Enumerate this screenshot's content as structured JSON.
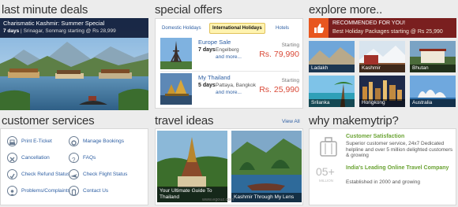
{
  "sections": {
    "deals": "last minute deals",
    "offers": "special offers",
    "explore": "explore more..",
    "services": "customer services",
    "travel": "travel ideas",
    "why": "why makemytrip?"
  },
  "deal": {
    "title": "Charismatic Kashmir: Summer Special",
    "days": "7 days",
    "detail": "Srinagar, Sonmarg starting @ Rs 28,999"
  },
  "offers": {
    "tabs": [
      "Domestic Holidays",
      "International Holidays",
      "Hotels"
    ],
    "active_tab": "International Holidays",
    "items": [
      {
        "name": "Europe Sale",
        "days": "7 days",
        "place": "Engelberg",
        "more": "and more...",
        "starting": "Starting",
        "price": "Rs. 79,990"
      },
      {
        "name": "My Thailand",
        "days": "5 days",
        "place": "Pattaya, Bangkok",
        "more": "and more...",
        "starting": "Starting",
        "price": "Rs. 25,990"
      }
    ]
  },
  "explore": {
    "recommended": "RECOMMENDED FOR YOU!",
    "recommended_detail": "Best Holiday Packages starting @ Rs 25,990",
    "destinations": [
      "Ladakh",
      "Kashmir",
      "Bhutan",
      "Srilanka",
      "Hongkong",
      "Australia"
    ]
  },
  "services": {
    "items": [
      {
        "label": "Print E-Ticket",
        "icon": "printer-icon"
      },
      {
        "label": "Manage Bookings",
        "icon": "gear-icon"
      },
      {
        "label": "Cancellation",
        "icon": "cancel-icon"
      },
      {
        "label": "FAQs",
        "icon": "question-icon"
      },
      {
        "label": "Check Refund Status",
        "icon": "refund-icon"
      },
      {
        "label": "Check Flight Status",
        "icon": "plane-icon"
      },
      {
        "label": "Problems/Complaints",
        "icon": "person-icon"
      },
      {
        "label": "Contact Us",
        "icon": "phone-icon"
      }
    ]
  },
  "travel": {
    "view_all": "View All",
    "ideas": [
      {
        "caption": "Your Ultimate Guide To Thailand"
      },
      {
        "caption": "Kashmir Through My Lens"
      }
    ]
  },
  "why": {
    "items": [
      {
        "head": "Customer Satisfaction",
        "desc": "Superior customer service, 24x7 Dedicated helpline and over 5 million delighted customers & growing"
      },
      {
        "head": "India's Leading Online Travel Company",
        "desc": "Established in 2000 and growing"
      }
    ],
    "stat": "05+",
    "stat_unit": "MILLION"
  },
  "watermark": "www.egouz.com",
  "colors": {
    "link": "#2e5fa3",
    "price": "#d94a38",
    "green": "#6aa333",
    "deal_bar": "#101c38",
    "rec_bar": "#7a1f1f",
    "like_orange": "#e8561f"
  }
}
